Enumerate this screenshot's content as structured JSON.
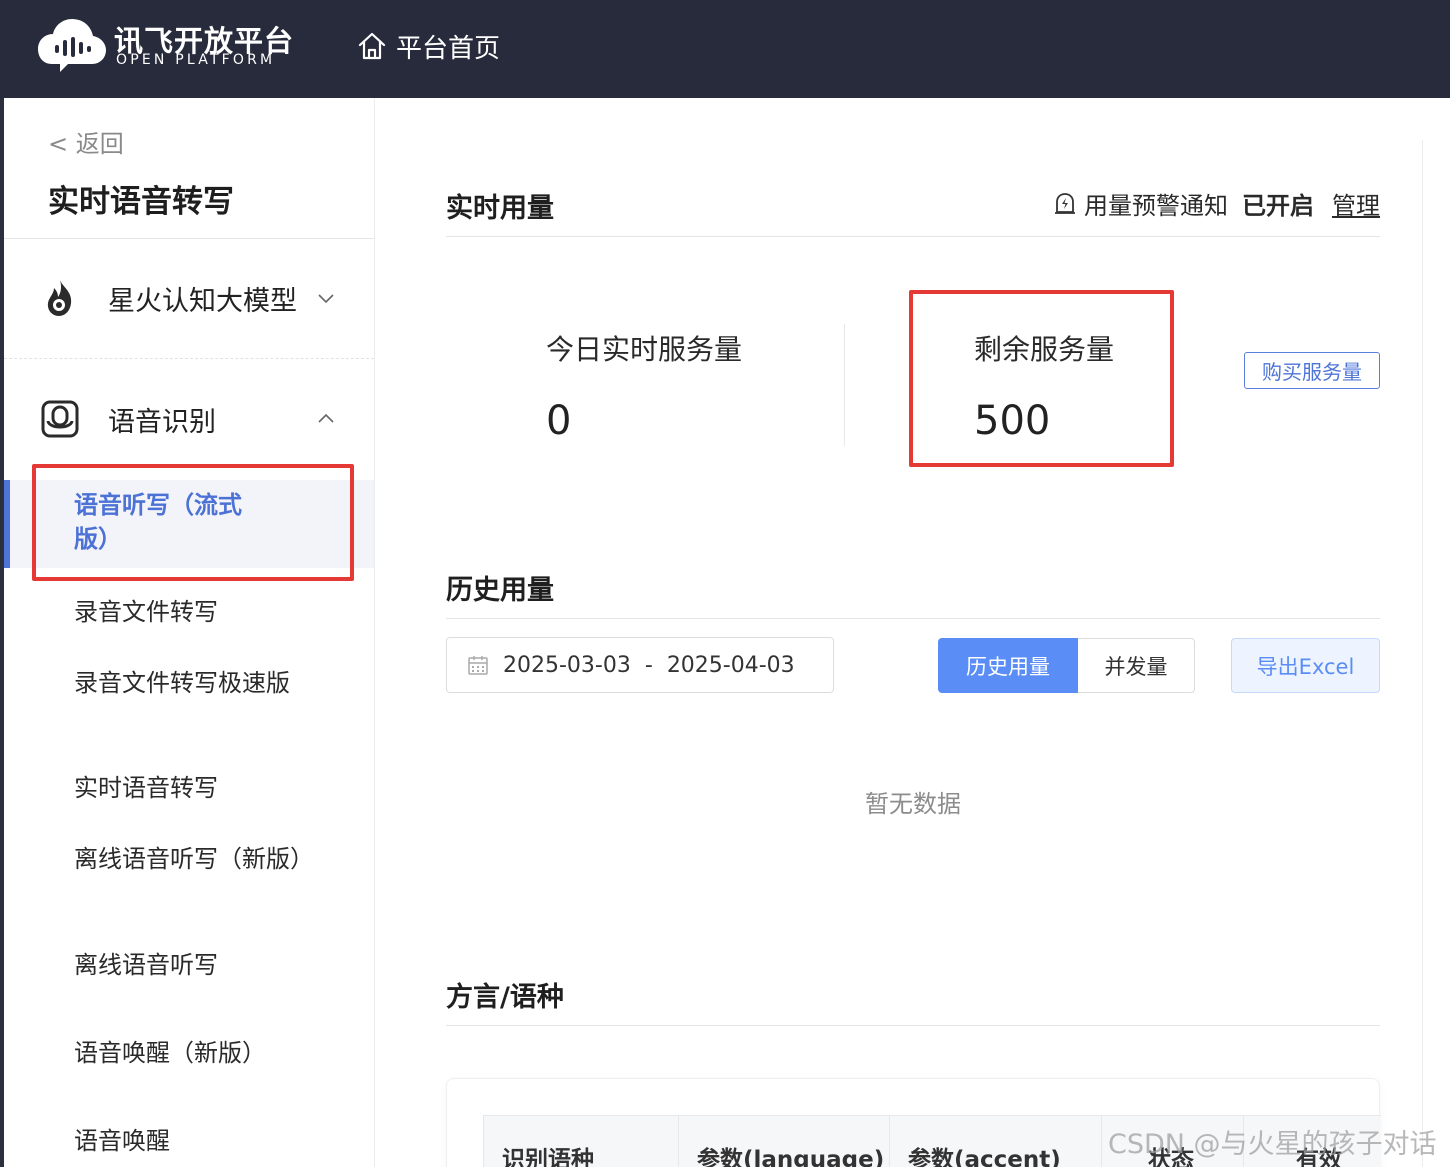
{
  "header": {
    "logo_cn": "讯飞开放平台",
    "logo_en": "OPEN PLATFORM",
    "home_label": "平台首页"
  },
  "sidebar": {
    "back_label": "< 返回",
    "title": "实时语音转写",
    "groups": [
      {
        "label": "星火认知大模型",
        "icon": "spark-flame-icon",
        "expanded": false
      },
      {
        "label": "语音识别",
        "icon": "speech-recognition-icon",
        "expanded": true
      }
    ],
    "active_item": "语音听写（流式版）",
    "items": [
      "录音文件转写",
      "录音文件转写极速版",
      "实时语音转写",
      "离线语音听写（新版）",
      "离线语音听写",
      "语音唤醒（新版）",
      "语音唤醒"
    ]
  },
  "realtime": {
    "title": "实时用量",
    "alert_label": "用量预警通知",
    "alert_status": "已开启",
    "manage_label": "管理",
    "today_label": "今日实时服务量",
    "today_value": "0",
    "remaining_label": "剩余服务量",
    "remaining_value": "500",
    "buy_label": "购买服务量"
  },
  "history": {
    "title": "历史用量",
    "date_start": "2025-03-03",
    "date_sep": "-",
    "date_end": "2025-04-03",
    "tabs": [
      "历史用量",
      "并发量"
    ],
    "active_tab": "历史用量",
    "export_label": "导出Excel",
    "empty_text": "暂无数据"
  },
  "dialect": {
    "title": "方言/语种",
    "columns": [
      "识别语种",
      "参数(language)",
      "参数(accent)",
      "状态",
      "有效"
    ]
  },
  "watermark": "CSDN @与火星的孩子对话",
  "colors": {
    "topbar": "#272b3b",
    "accent": "#4f74d8",
    "tab_active": "#5a8df5",
    "highlight": "#e53935"
  }
}
